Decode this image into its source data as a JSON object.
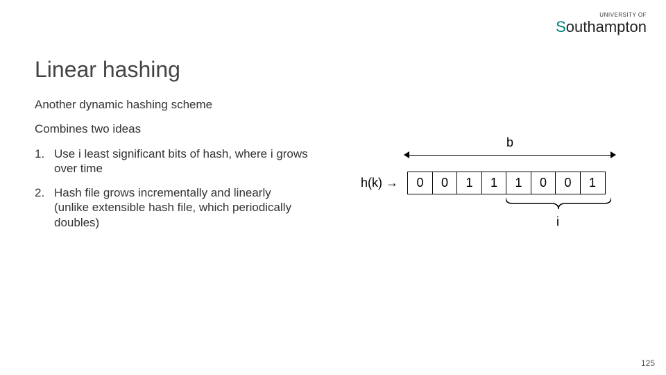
{
  "logo": {
    "top": "UNIVERSITY OF",
    "main_first": "S",
    "main_rest": "outhampton"
  },
  "title": "Linear hashing",
  "p1": "Another dynamic hashing scheme",
  "p2": "Combines two ideas",
  "items": [
    {
      "num": "1.",
      "text": "Use i least significant bits of hash, where i grows over time"
    },
    {
      "num": "2.",
      "text": "Hash file grows incrementally and linearly\n(unlike extensible hash file, which periodically doubles)"
    }
  ],
  "diagram": {
    "b_label": "b",
    "hk_label": "h(k) →",
    "bits": [
      "0",
      "0",
      "1",
      "1",
      "1",
      "0",
      "0",
      "1"
    ],
    "i_label": "i"
  },
  "page_number": "125",
  "chart_data": {
    "type": "table",
    "title": "Hash bit vector example",
    "b_span": 8,
    "i_span": 4,
    "bits": [
      0,
      0,
      1,
      1,
      1,
      0,
      0,
      1
    ]
  }
}
